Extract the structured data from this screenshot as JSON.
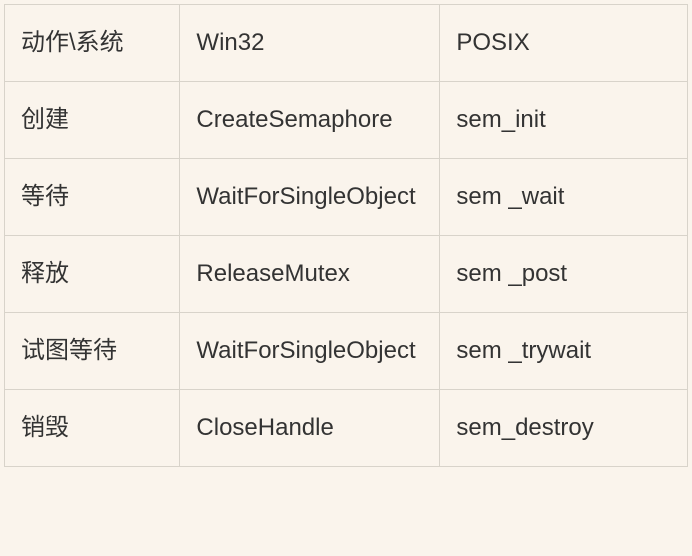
{
  "table": {
    "rows": [
      {
        "c0": "动作\\系统",
        "c1": "Win32",
        "c2": "POSIX"
      },
      {
        "c0": "创建",
        "c1": "CreateSemaphore",
        "c2": "sem_init"
      },
      {
        "c0": "等待",
        "c1": "WaitForSingleObject",
        "c2": "sem _wait"
      },
      {
        "c0": "释放",
        "c1": "ReleaseMutex",
        "c2": "sem _post"
      },
      {
        "c0": "试图等待",
        "c1": "WaitForSingleObject",
        "c2": "sem _trywait"
      },
      {
        "c0": "销毁",
        "c1": "CloseHandle",
        "c2": "sem_destroy"
      }
    ]
  }
}
